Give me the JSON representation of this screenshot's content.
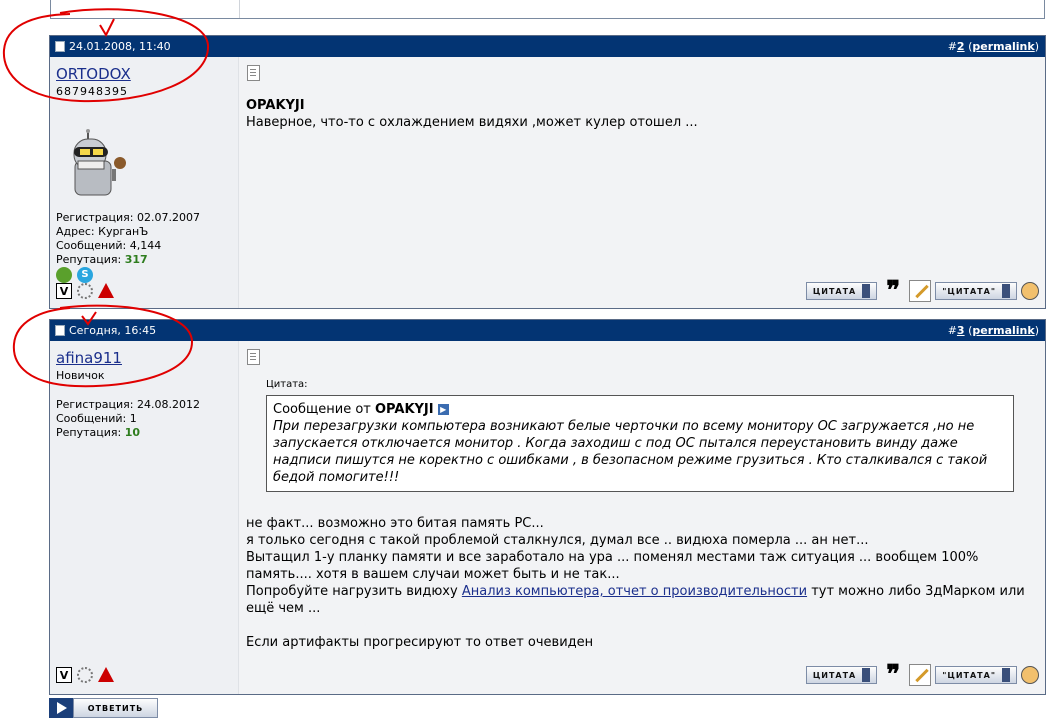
{
  "posts": [
    {
      "date": "24.01.2008, 11:40",
      "post_hash": "#",
      "post_no": "2",
      "open_paren": "(",
      "permalink": "permalink",
      "close_paren": ")",
      "username": "ORTODOX",
      "user_id_text": "687948395",
      "reg": "Регистрация: 02.07.2007",
      "address": "Адрес: КурганЪ",
      "messages": "Сообщений: 4,144",
      "rep_label": "Репутация:",
      "rep_value": "317",
      "title_bold": "OPAKYJI",
      "text": "Наверное, что-то с охлаждением видяхи ,может кулер отошел ..."
    },
    {
      "date": "Сегодня, 16:45",
      "post_hash": "#",
      "post_no": "3",
      "open_paren": "(",
      "permalink": "permalink",
      "close_paren": ")",
      "username": "afina911",
      "user_title": "Новичок",
      "reg": "Регистрация: 24.08.2012",
      "messages": "Сообщений: 1",
      "rep_label": "Репутация:",
      "rep_value": "10",
      "quote_label": "Цитата:",
      "quote_from": "Сообщение от",
      "quote_author": "OPAKYJI",
      "quote_lines": [
        "При перезагрузки компьютера возникают белые черточки по всему монитору ОС загружается ,но не",
        "запускается отключается монитор . Когда заходиш с под ОС пытался переустановить винду даже",
        "надписи пишутся не коректно с ошибками , в безопасном режиме грузиться . Кто сталкивался с такой",
        "бедой помогите!!!"
      ],
      "lines": [
        "не факт... возможно это битая память PC...",
        "я только сегодня с такой проблемой сталкнулся, думал все .. видюха померла ... ан нет...",
        "Вытащил 1-у планку памяти и все заработало на ура ... поменял местами таж ситуация ... вообщем 100%",
        "память.... хотя в вашем случаи может быть и не так..."
      ],
      "line5_pre": "Попробуйте нагрузить видюху",
      "line5_link": "Анализ компьютера, отчет о производительности",
      "line5_post": "тут можно либо 3дМарком или",
      "line6": "ещё чем ...",
      "line7": "Если артифакты прогресируют то ответ очевиден"
    }
  ],
  "buttons": {
    "quote": "ЦИТАТА",
    "multi_quote": "\"ЦИТАТА\"",
    "reply": "ОТВЕТИТЬ"
  },
  "icons": {
    "v_letter": "V",
    "skype_letter": "S"
  },
  "colors": {
    "header_bg": "#033473",
    "rep_green": "#2e7d1e",
    "annotation_red": "#e00000"
  }
}
